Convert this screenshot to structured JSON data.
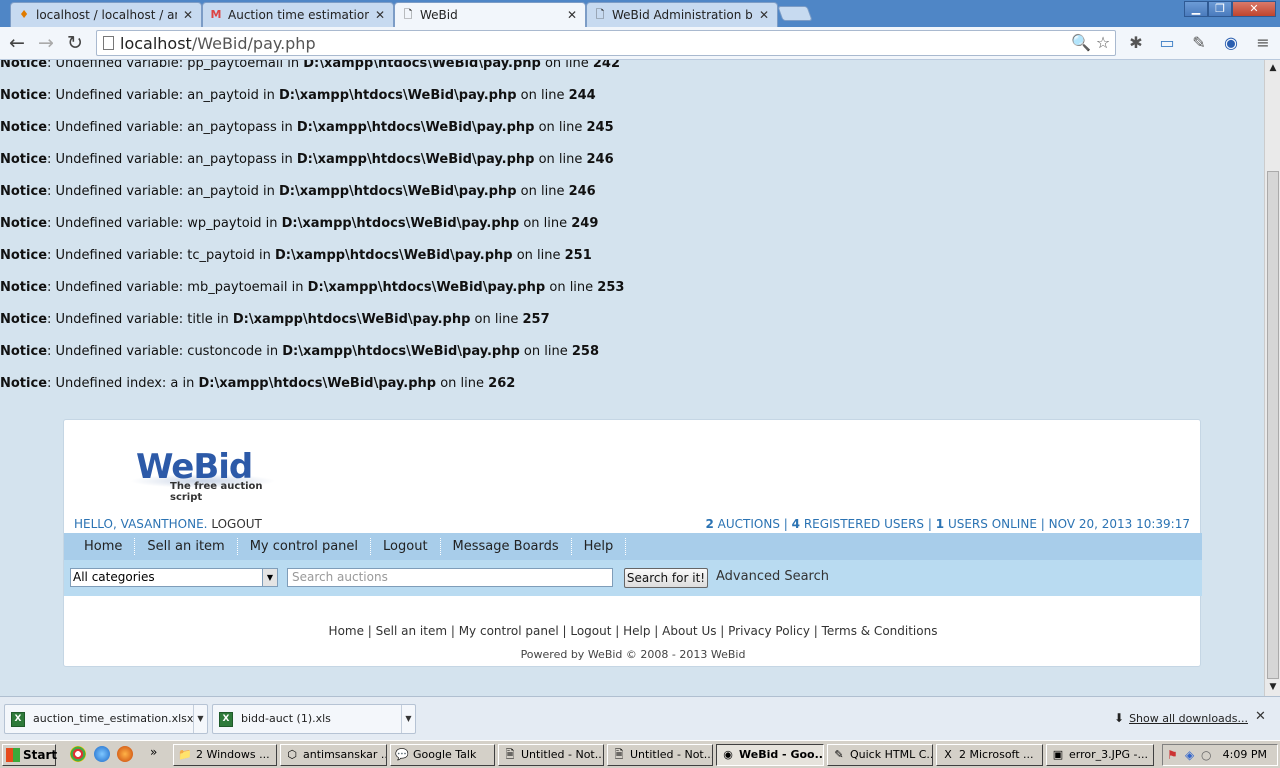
{
  "browser": {
    "tabs": [
      {
        "title": "localhost / localhost / antims",
        "icon": "phpmyadmin-icon"
      },
      {
        "title": "Auction time estimation - va",
        "icon": "gmail-icon"
      },
      {
        "title": "WeBid",
        "icon": "page-icon"
      },
      {
        "title": "WeBid Administration back-e",
        "icon": "page-icon"
      }
    ],
    "url_host": "localhost",
    "url_path": "/WeBid/pay.php"
  },
  "notices": [
    {
      "label": "Notice",
      "msg": ": Undefined variable: pp_paytoemail in ",
      "file": "D:\\xampp\\htdocs\\WeBid\\pay.php",
      "on": " on line ",
      "line": "242"
    },
    {
      "label": "Notice",
      "msg": ": Undefined variable: an_paytoid in ",
      "file": "D:\\xampp\\htdocs\\WeBid\\pay.php",
      "on": " on line ",
      "line": "244"
    },
    {
      "label": "Notice",
      "msg": ": Undefined variable: an_paytopass in ",
      "file": "D:\\xampp\\htdocs\\WeBid\\pay.php",
      "on": " on line ",
      "line": "245"
    },
    {
      "label": "Notice",
      "msg": ": Undefined variable: an_paytopass in ",
      "file": "D:\\xampp\\htdocs\\WeBid\\pay.php",
      "on": " on line ",
      "line": "246"
    },
    {
      "label": "Notice",
      "msg": ": Undefined variable: an_paytoid in ",
      "file": "D:\\xampp\\htdocs\\WeBid\\pay.php",
      "on": " on line ",
      "line": "246"
    },
    {
      "label": "Notice",
      "msg": ": Undefined variable: wp_paytoid in ",
      "file": "D:\\xampp\\htdocs\\WeBid\\pay.php",
      "on": " on line ",
      "line": "249"
    },
    {
      "label": "Notice",
      "msg": ": Undefined variable: tc_paytoid in ",
      "file": "D:\\xampp\\htdocs\\WeBid\\pay.php",
      "on": " on line ",
      "line": "251"
    },
    {
      "label": "Notice",
      "msg": ": Undefined variable: mb_paytoemail in ",
      "file": "D:\\xampp\\htdocs\\WeBid\\pay.php",
      "on": " on line ",
      "line": "253"
    },
    {
      "label": "Notice",
      "msg": ": Undefined variable: title in ",
      "file": "D:\\xampp\\htdocs\\WeBid\\pay.php",
      "on": " on line ",
      "line": "257"
    },
    {
      "label": "Notice",
      "msg": ": Undefined variable: custoncode in ",
      "file": "D:\\xampp\\htdocs\\WeBid\\pay.php",
      "on": " on line ",
      "line": "258"
    },
    {
      "label": "Notice",
      "msg": ": Undefined index: a in ",
      "file": "D:\\xampp\\htdocs\\WeBid\\pay.php",
      "on": " on line ",
      "line": "262"
    }
  ],
  "webid": {
    "logo_text": "WeBid",
    "logo_tagline": "The free auction script",
    "hello": "HELLO, VASANTHONE.",
    "logout": "LOGOUT",
    "stats": {
      "auctions_n": "2",
      "auctions_l": "AUCTIONS",
      "users_n": "4",
      "users_l": "REGISTERED USERS",
      "online_n": "1",
      "online_l": "USERS ONLINE",
      "datetime": "NOV 20, 2013 10:39:17",
      "sep": "|"
    },
    "menu": [
      "Home",
      "Sell an item",
      "My control panel",
      "Logout",
      "Message Boards",
      "Help"
    ],
    "category_selected": "All categories",
    "search_placeholder": "Search auctions",
    "search_button": "Search for it!",
    "advanced_search": "Advanced Search",
    "footer_links": [
      "Home",
      "Sell an item",
      "My control panel",
      "Logout",
      "Help",
      "About Us",
      "Privacy Policy",
      "Terms & Conditions"
    ],
    "powered": "Powered by WeBid © 2008 - 2013 WeBid"
  },
  "downloads": {
    "items": [
      "auction_time_estimation.xlsx",
      "bidd-auct (1).xls"
    ],
    "show_all": "Show all downloads..."
  },
  "taskbar": {
    "start": "Start",
    "tasks": [
      {
        "label": "2 Windows ...",
        "icon": "folder-icon"
      },
      {
        "label": "antimsanskar ...",
        "icon": "app-icon"
      },
      {
        "label": "Google Talk",
        "icon": "chat-icon"
      },
      {
        "label": "Untitled - Not...",
        "icon": "notepad-icon"
      },
      {
        "label": "Untitled - Not...",
        "icon": "notepad-icon"
      },
      {
        "label": "WeBid - Goo...",
        "icon": "chrome-icon"
      },
      {
        "label": "Quick HTML C...",
        "icon": "tool-icon"
      },
      {
        "label": "2 Microsoft ...",
        "icon": "excel-icon"
      },
      {
        "label": "error_3.JPG -...",
        "icon": "image-icon"
      }
    ],
    "clock": "4:09 PM"
  }
}
